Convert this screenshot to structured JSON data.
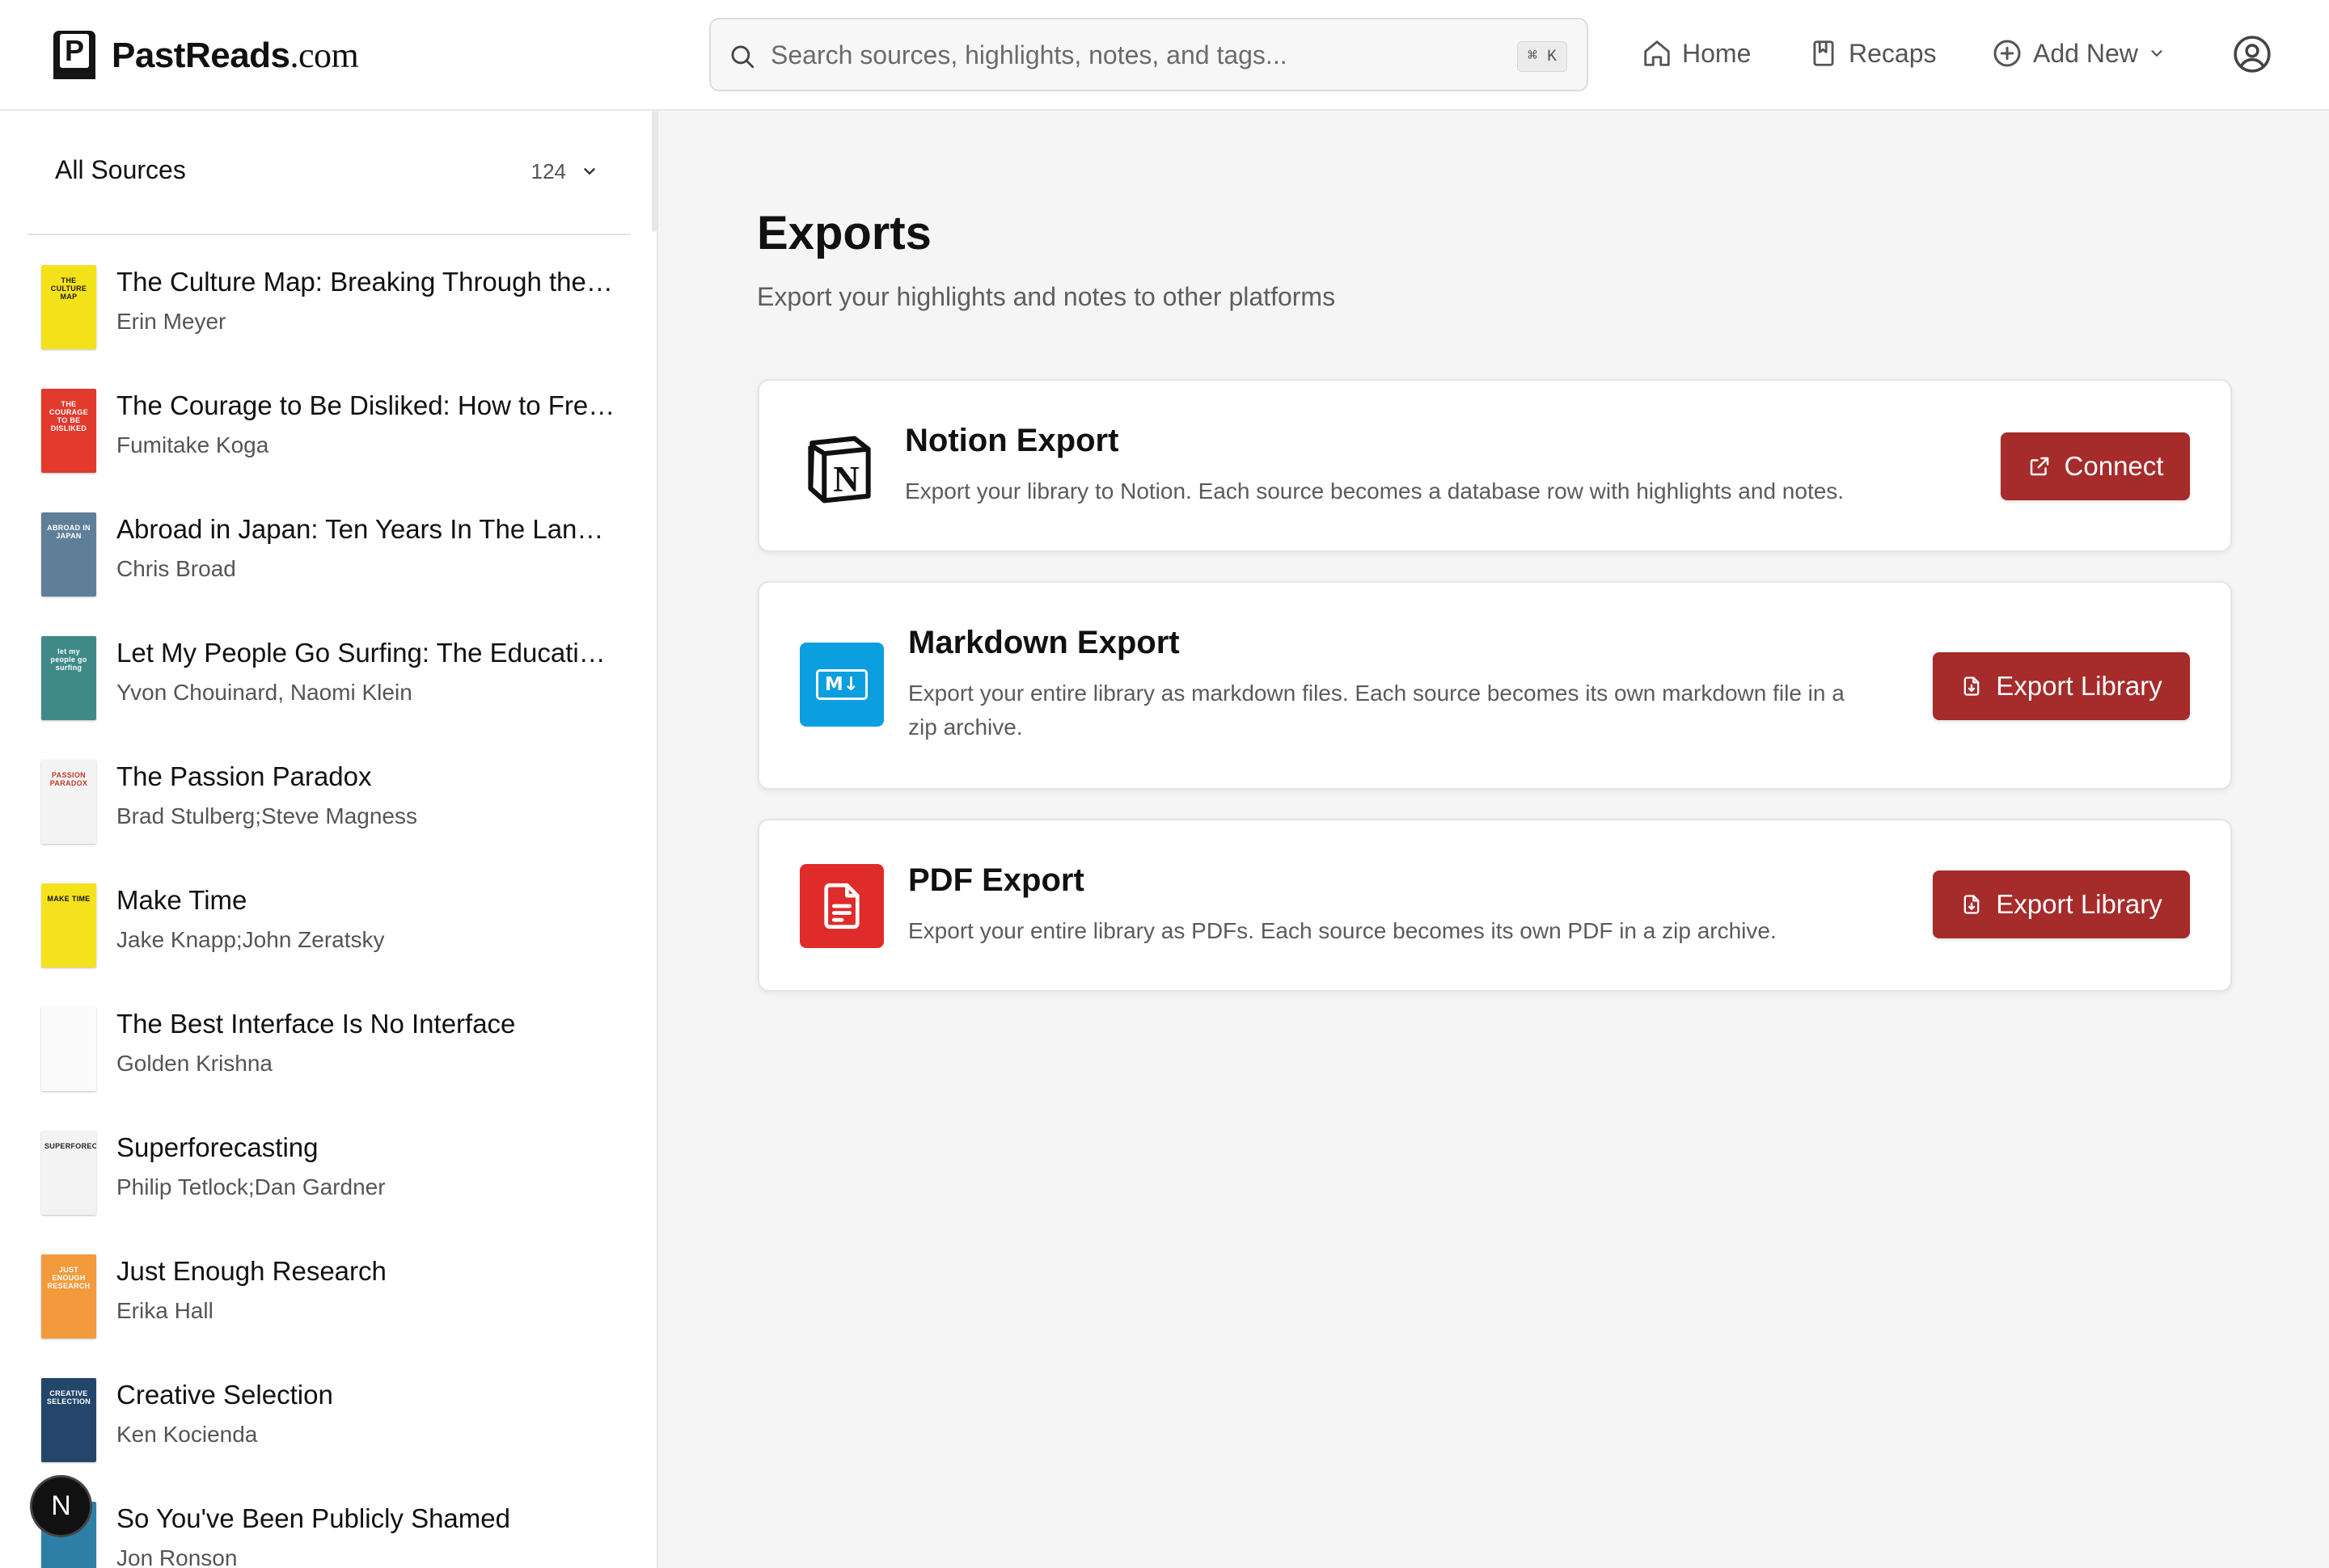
{
  "brand": {
    "letter": "P",
    "name": "PastReads",
    "tld": ".com"
  },
  "search": {
    "placeholder": "Search sources, highlights, notes, and tags...",
    "shortcut": "⌘ K"
  },
  "nav": {
    "home": "Home",
    "recaps": "Recaps",
    "add_new": "Add New"
  },
  "sidebar": {
    "filter_label": "All Sources",
    "count": "124",
    "books": [
      {
        "title": "The Culture Map: Breaking Through the Invisible Boundaries of Global Business",
        "author": "Erin Meyer",
        "cover_bg": "#f4e11a",
        "cover_fg": "#1a1a1a",
        "cover_text": "THE CULTURE MAP"
      },
      {
        "title": "The Courage to Be Disliked: How to Free Yourself, Change Your Life, and Achieve Real Happiness",
        "author": "Fumitake Koga",
        "cover_bg": "#e23a2c",
        "cover_fg": "#ffffff",
        "cover_text": "THE COURAGE TO BE DISLIKED"
      },
      {
        "title": "Abroad in Japan: Ten Years In The Land of the Rising Sun",
        "author": "Chris Broad",
        "cover_bg": "#5f7f99",
        "cover_fg": "#ffffff",
        "cover_text": "ABROAD IN JAPAN"
      },
      {
        "title": "Let My People Go Surfing: The Education of a Reluctant Businessman",
        "author": "Yvon Chouinard, Naomi Klein",
        "cover_bg": "#3f8a86",
        "cover_fg": "#ffffff",
        "cover_text": "let my people go surfing"
      },
      {
        "title": "The Passion Paradox",
        "author": "Brad Stulberg;Steve Magness",
        "cover_bg": "#f4f4f4",
        "cover_fg": "#c0392b",
        "cover_text": "PASSION PARADOX"
      },
      {
        "title": "Make Time",
        "author": "Jake Knapp;John Zeratsky",
        "cover_bg": "#f5e21c",
        "cover_fg": "#111111",
        "cover_text": "MAKE TIME"
      },
      {
        "title": "The Best Interface Is No Interface",
        "author": "Golden Krishna",
        "cover_bg": "#fafafa",
        "cover_fg": "#999999",
        "cover_text": ""
      },
      {
        "title": "Superforecasting",
        "author": "Philip Tetlock;Dan Gardner",
        "cover_bg": "#f3f3f3",
        "cover_fg": "#222222",
        "cover_text": "SUPERFORECASTING"
      },
      {
        "title": "Just Enough Research",
        "author": "Erika Hall",
        "cover_bg": "#f39a3c",
        "cover_fg": "#ffffff",
        "cover_text": "JUST ENOUGH RESEARCH"
      },
      {
        "title": "Creative Selection",
        "author": "Ken Kocienda",
        "cover_bg": "#24466b",
        "cover_fg": "#ffffff",
        "cover_text": "CREATIVE SELECTION"
      },
      {
        "title": "So You've Been Publicly Shamed",
        "author": "Jon Ronson",
        "cover_bg": "#2d7fa8",
        "cover_fg": "#ffffff",
        "cover_text": ""
      }
    ]
  },
  "fab_label": "N",
  "page": {
    "title": "Exports",
    "subtitle": "Export your highlights and notes to other platforms"
  },
  "exports": {
    "notion": {
      "title": "Notion Export",
      "desc": "Export your library to Notion. Each source becomes a database row with highlights and notes.",
      "button": "Connect"
    },
    "markdown": {
      "title": "Markdown Export",
      "desc": "Export your entire library as markdown files. Each source becomes its own markdown file in a zip archive.",
      "button": "Export Library",
      "icon_text": "M↓"
    },
    "pdf": {
      "title": "PDF Export",
      "desc": "Export your entire library as PDFs. Each source becomes its own PDF in a zip archive.",
      "button": "Export Library"
    }
  },
  "colors": {
    "accent": "#a62b2b",
    "markdown_icon": "#0b9fe0",
    "pdf_icon": "#e02b2b"
  }
}
